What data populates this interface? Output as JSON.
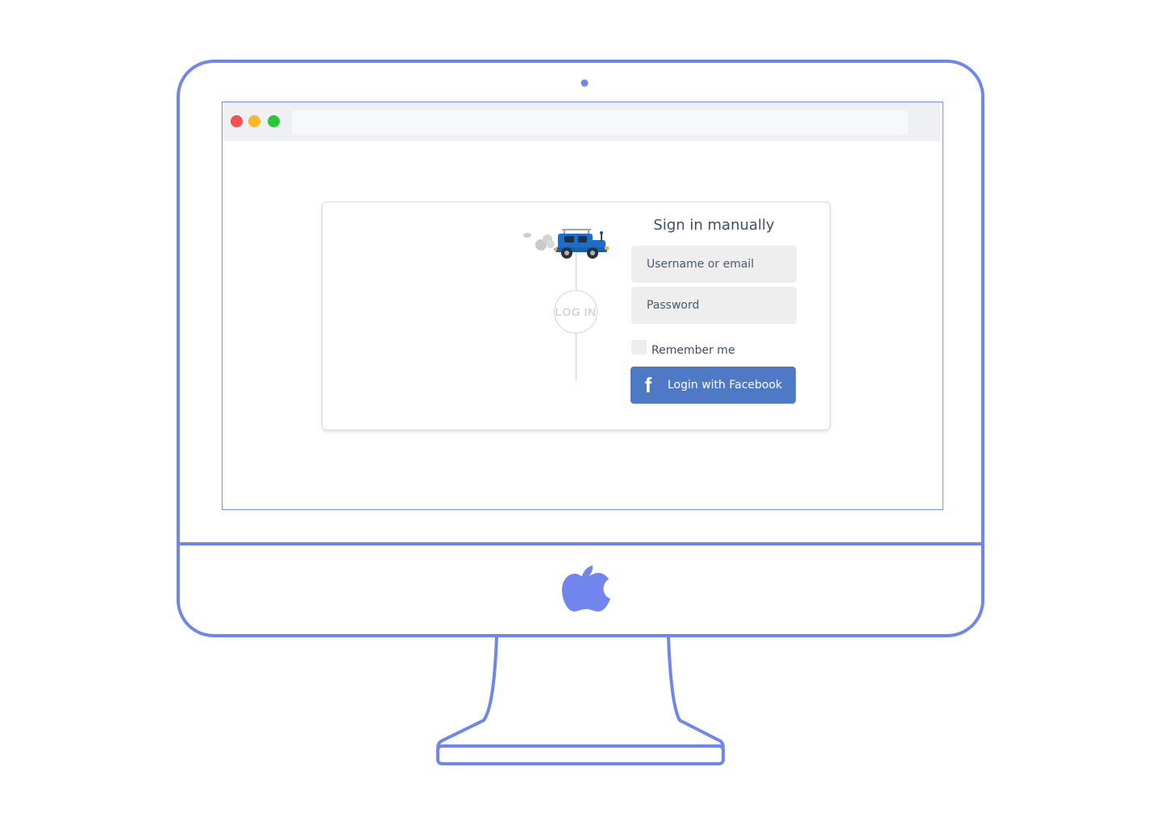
{
  "device": {
    "outline_color": "#7086ee",
    "logo_icon": "apple-logo-icon"
  },
  "browser": {
    "window_controls": [
      {
        "name": "close",
        "color": "#f2524f"
      },
      {
        "name": "minimize",
        "color": "#f8b82a"
      },
      {
        "name": "maximize",
        "color": "#27c73c"
      }
    ],
    "url": ""
  },
  "login": {
    "illustration_icon": "jeep-car-icon",
    "circle_label": "LOG IN",
    "title": "Sign in manually",
    "username_placeholder": "Username or email",
    "username_value": "",
    "password_placeholder": "Password",
    "password_value": "",
    "remember_label": "Remember me",
    "remember_checked": false,
    "facebook_icon": "facebook-f-icon",
    "facebook_button_label": "Login with Facebook",
    "facebook_color": "#4e7ac5"
  }
}
